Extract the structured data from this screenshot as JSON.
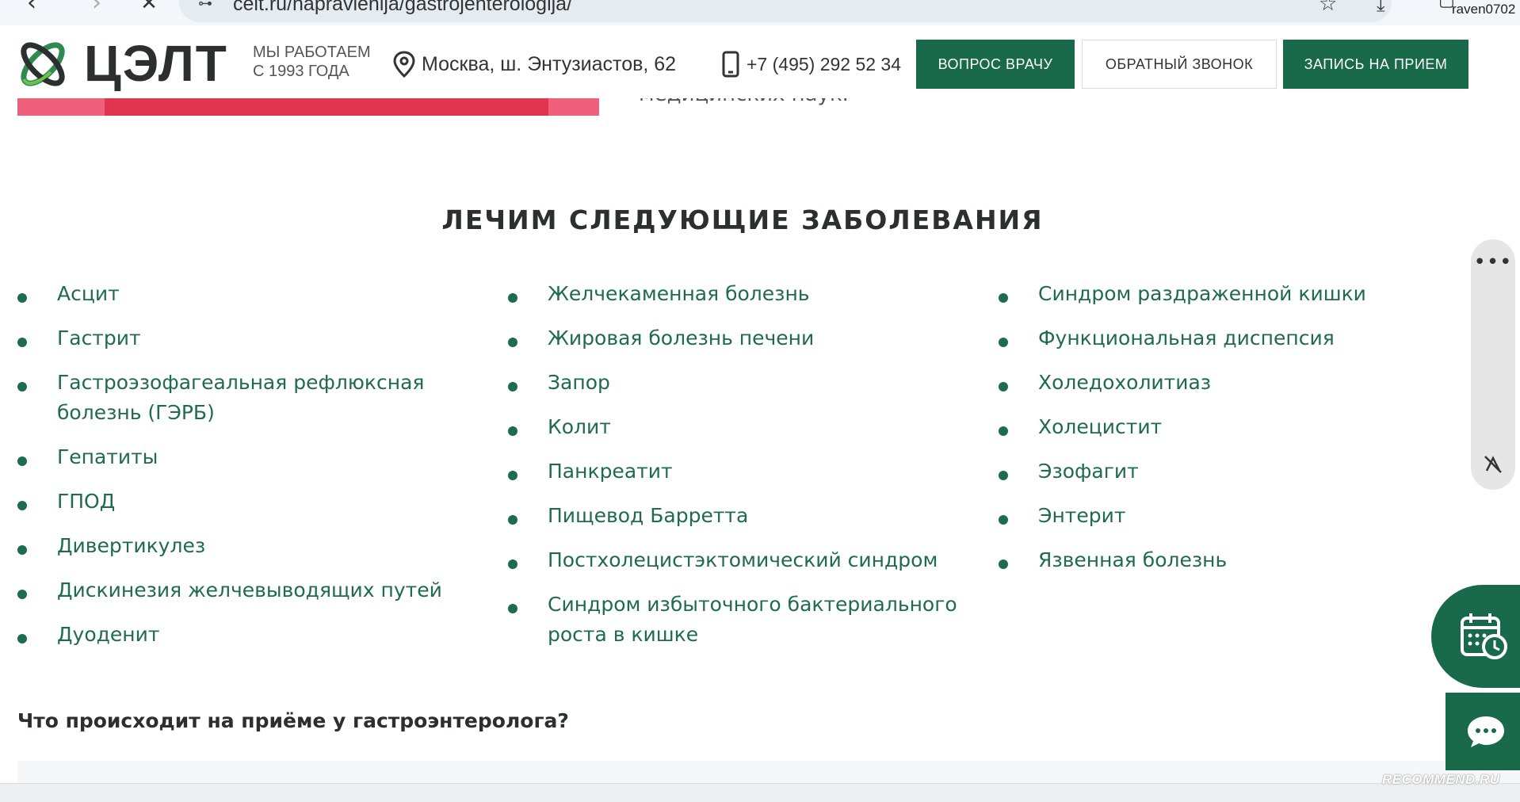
{
  "browser": {
    "url": "celt.ru/napravlenija/gastrojenterologija/",
    "user": "raven0702"
  },
  "header": {
    "logo_text": "ЦЭЛТ",
    "since_line1": "МЫ РАБОТАЕМ",
    "since_line2": "С 1993 ГОДА",
    "address": "Москва, ш. Энтузиастов, 62",
    "phone": "+7 (495) 292 52 34",
    "btn_question": "ВОПРОС ВРАЧУ",
    "btn_callback": "ОБРАТНЫЙ ЗВОНОК",
    "btn_appointment": "ЗАПИСЬ НА ПРИЕМ"
  },
  "hero": {
    "cut_text": "медицинских наук."
  },
  "section": {
    "title": "ЛЕЧИМ СЛЕДУЮЩИЕ ЗАБОЛЕВАНИЯ",
    "col1": [
      "Асцит",
      "Гастрит",
      "Гастроэзофагеальная рефлюксная болезнь (ГЭРБ)",
      "Гепатиты",
      "ГПОД",
      "Дивертикулез",
      "Дискинезия желчевыводящих путей",
      "Дуоденит"
    ],
    "col2": [
      "Желчекаменная болезнь",
      "Жировая болезнь печени",
      "Запор",
      "Колит",
      "Панкреатит",
      "Пищевод Барретта",
      "Постхолецистэктомический синдром",
      "Синдром избыточного бактериального роста в кишке"
    ],
    "col3": [
      "Синдром раздраженной кишки",
      "Функциональная диспепсия",
      "Холедохолитиаз",
      "Холецистит",
      "Эзофагит",
      "Энтерит",
      "Язвенная болезнь"
    ]
  },
  "faq": {
    "question": "Что происходит на приёме у гастроэнтеролога?"
  },
  "floating": {
    "menu_dots": "•••"
  },
  "watermark": "RECOMMEND.RU",
  "colors": {
    "brand_green": "#186a4b",
    "link_green": "#1f6b4d",
    "hero_pink": "#f0607a"
  }
}
